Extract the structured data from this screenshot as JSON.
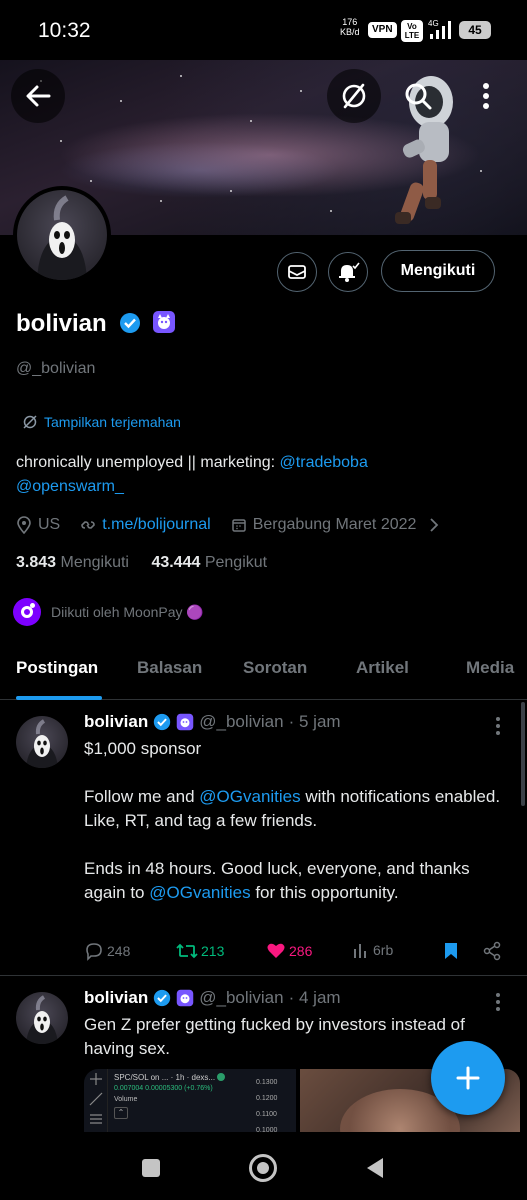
{
  "status": {
    "time": "10:32",
    "speed": "176",
    "speed_unit": "KB/d",
    "vpn": "VPN",
    "volte": "Vo LTE",
    "network": "4G",
    "battery": "45"
  },
  "profile": {
    "name": "bolivian",
    "handle": "@_bolivian",
    "translate_label": "Tampilkan terjemahan",
    "bio_text": "chronically unemployed || marketing: ",
    "bio_link1": "@tradeboba",
    "bio_link2": "@openswarm_",
    "location": "US",
    "website": "t.me/bolijournal",
    "joined": "Bergabung Maret 2022",
    "following_count": "3.843",
    "following_label": "Mengikuti",
    "followers_count": "43.444",
    "followers_label": "Pengikut",
    "followed_by": "Diikuti oleh MoonPay 🟣",
    "follow_button": "Mengikuti"
  },
  "tabs": [
    "Postingan",
    "Balasan",
    "Sorotan",
    "Artikel",
    "Media"
  ],
  "posts": [
    {
      "name": "bolivian",
      "handle": "@_bolivian",
      "time": "· 5 jam",
      "text_a": "$1,000 sponsor",
      "text_b1": "Follow me and ",
      "mention1": "@OGvanities",
      "text_b2": " with notifications enabled.",
      "text_c": "Like, RT, and tag a few friends.",
      "text_d1": "Ends in 48 hours. Good luck, everyone, and thanks again to ",
      "mention2": "@OGvanities",
      "text_d2": " for this opportunity.",
      "replies": "248",
      "reposts": "213",
      "likes": "286",
      "views": "6rb"
    },
    {
      "name": "bolivian",
      "handle": "@_bolivian",
      "time": "· 4 jam",
      "text": "Gen Z prefer getting fucked by investors instead of having sex.",
      "media_chart": {
        "pair": "SPC/SOL on ...",
        "interval": "· 1h · dexs...",
        "price": "0.007004",
        "change": "0.00005300 (+0.76%)",
        "volume_label": "Volume",
        "ticks": [
          "0.1300",
          "0.1200",
          "0.1100",
          "0.1000"
        ]
      }
    }
  ],
  "colors": {
    "accent": "#1d9bf0",
    "like": "#f91880",
    "repost": "#00ba7c",
    "verified": "#1d9bf0",
    "affiliate": "#7856ff"
  }
}
